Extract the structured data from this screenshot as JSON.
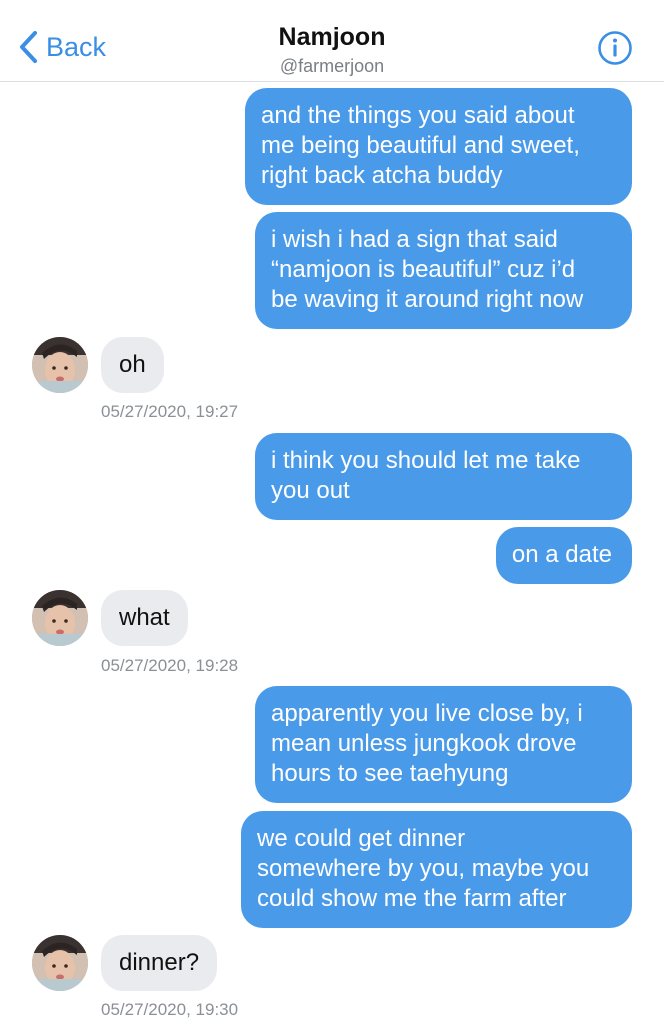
{
  "header": {
    "back_label": "Back",
    "title": "Namjoon",
    "handle": "@farmerjoon",
    "accent_color": "#3a8ee6",
    "icons": {
      "back": "chevron-left-icon",
      "info": "info-icon"
    }
  },
  "messages": [
    {
      "from": "me",
      "text": "and the things you said about\nme being beautiful and sweet,\nright back atcha buddy"
    },
    {
      "from": "me",
      "text": "i wish i had a sign that said\n“namjoon is beautiful” cuz i’d\nbe waving it around right now"
    },
    {
      "from": "them",
      "text": "oh",
      "timestamp": "05/27/2020, 19:27"
    },
    {
      "from": "me",
      "text": "i think you should let me take\nyou out"
    },
    {
      "from": "me",
      "text": "on a date"
    },
    {
      "from": "them",
      "text": "what",
      "timestamp": "05/27/2020, 19:28"
    },
    {
      "from": "me",
      "text": "apparently you live close by, i\nmean unless jungkook drove\nhours to see taehyung"
    },
    {
      "from": "me",
      "text": "we could get dinner\nsomewhere by you, maybe you\ncould show me the farm after"
    },
    {
      "from": "them",
      "text": "dinner?",
      "timestamp": "05/27/2020, 19:30"
    }
  ],
  "colors": {
    "outgoing_bubble": "#4a9aea",
    "incoming_bubble": "#e9ebee",
    "timestamp_text": "#8b9096"
  }
}
